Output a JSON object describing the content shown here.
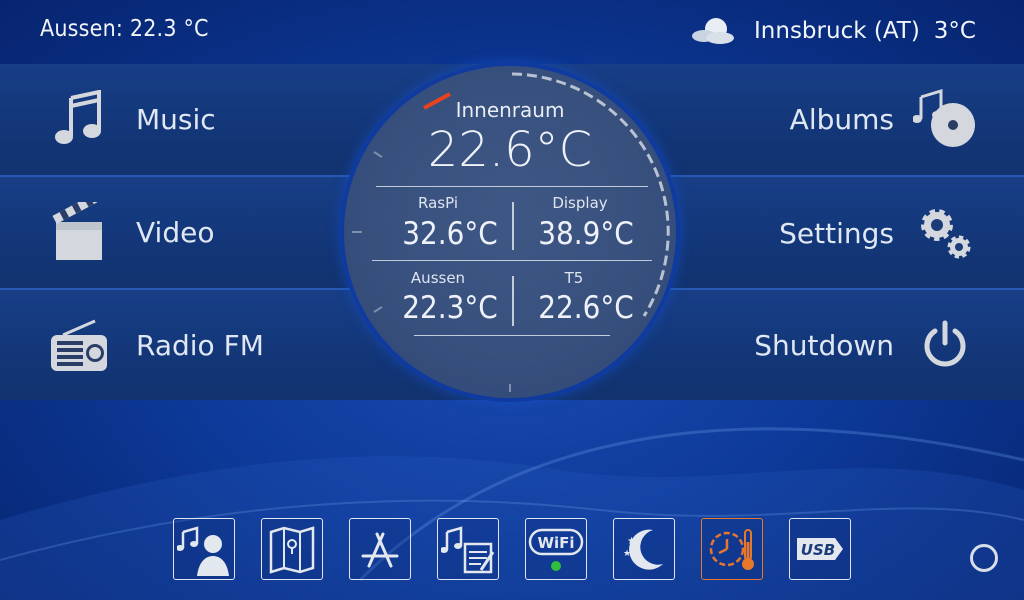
{
  "topbar": {
    "outside_temp": "Aussen: 22.3 °C",
    "location": "Innsbruck (AT)",
    "weather_temp": "3°C",
    "weather_icon": "cloudy-moon-icon"
  },
  "menu": {
    "left": [
      {
        "label": "Music",
        "icon": "music-note-icon"
      },
      {
        "label": "Video",
        "icon": "clapperboard-icon"
      },
      {
        "label": "Radio FM",
        "icon": "radio-icon"
      }
    ],
    "right": [
      {
        "label": "Albums",
        "icon": "album-disc-icon"
      },
      {
        "label": "Settings",
        "icon": "gears-icon"
      },
      {
        "label": "Shutdown",
        "icon": "power-icon"
      }
    ]
  },
  "gauge": {
    "title": "Innenraum",
    "main_value": "22.6°C",
    "cells": [
      {
        "label": "RasPi",
        "value": "32.6°C"
      },
      {
        "label": "Display",
        "value": "38.9°C"
      },
      {
        "label": "Aussen",
        "value": "22.3°C"
      },
      {
        "label": "T5",
        "value": "22.6°C"
      }
    ],
    "marker_color": "#e8421e"
  },
  "dock": [
    {
      "icon": "music-person-icon",
      "active": false
    },
    {
      "icon": "map-icon",
      "active": false
    },
    {
      "icon": "app-store-icon",
      "active": false
    },
    {
      "icon": "music-notes-icon",
      "active": false
    },
    {
      "icon": "wifi-icon",
      "active": false,
      "status": "connected"
    },
    {
      "icon": "night-mode-icon",
      "active": false
    },
    {
      "icon": "clock-thermometer-icon",
      "active": true
    },
    {
      "icon": "usb-icon",
      "active": false
    }
  ],
  "colors": {
    "accent_active": "#e8772b",
    "wifi_status": "#2fbf3a"
  }
}
